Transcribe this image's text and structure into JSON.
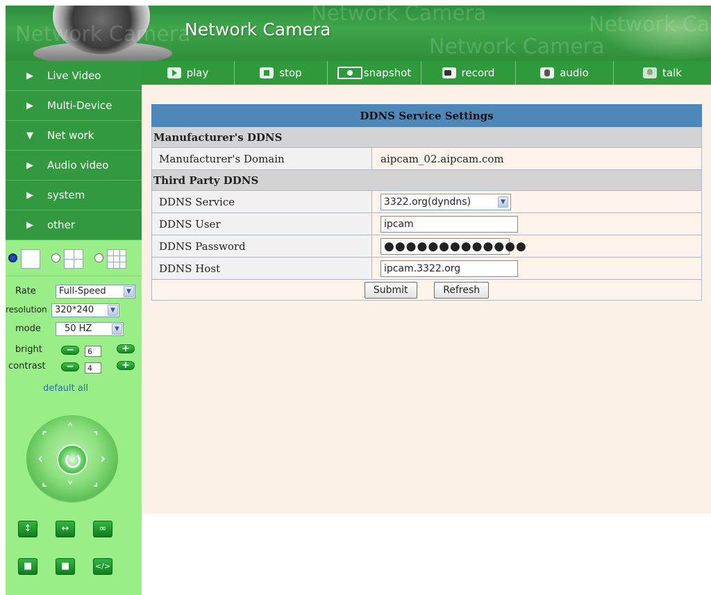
{
  "banner": {
    "title": "Network Camera",
    "watermark": "Network Camera"
  },
  "nav": {
    "items": [
      {
        "label": "Live Video",
        "arrow": "▶"
      },
      {
        "label": "Multi-Device",
        "arrow": "▶"
      },
      {
        "label": "Net work",
        "arrow": "▼"
      },
      {
        "label": "Audio video",
        "arrow": "▶"
      },
      {
        "label": "system",
        "arrow": "▶"
      },
      {
        "label": "other",
        "arrow": "▶"
      }
    ]
  },
  "toolbar": {
    "play": "play",
    "stop": "stop",
    "snapshot": "snapshot",
    "record": "record",
    "audio": "audio",
    "talk": "talk"
  },
  "controls": {
    "split_selected": 1,
    "rate_label": "Rate",
    "rate_value": "Full-Speed",
    "resolution_label": "resolution",
    "resolution_value": "320*240",
    "mode_label": "mode",
    "mode_value": "50 HZ",
    "bright_label": "bright",
    "bright_value": "6",
    "contrast_label": "contrast",
    "contrast_value": "4",
    "default_all": "default all"
  },
  "ddns": {
    "title": "DDNS Service Settings",
    "manufacturer_section": "Manufacturer's DDNS",
    "domain_label": "Manufacturer's Domain",
    "domain_value": "aipcam_02.aipcam.com",
    "third_party_section": "Third Party DDNS",
    "service_label": "DDNS Service",
    "service_value": "3322.org(dyndns)",
    "user_label": "DDNS User",
    "user_value": "ipcam",
    "password_label": "DDNS Password",
    "password_value": "●●●●●●●●●●●●●",
    "host_label": "DDNS Host",
    "host_value": "ipcam.3322.org",
    "submit_label": "Submit",
    "refresh_label": "Refresh"
  },
  "colors": {
    "nav_green": "#33993f",
    "panel_green": "#99ee88",
    "header_blue": "#4d88b8",
    "content_bg": "#fbf1e6"
  }
}
